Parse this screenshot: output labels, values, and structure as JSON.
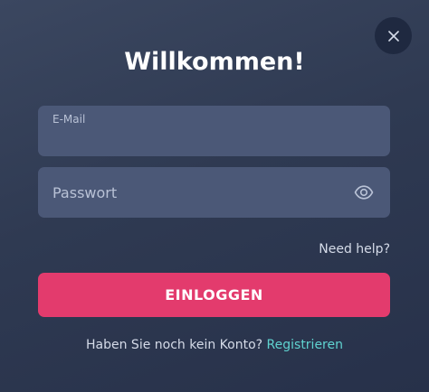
{
  "modal": {
    "title": "Willkommen!",
    "close_icon": "close-icon"
  },
  "form": {
    "email": {
      "label": "E-Mail",
      "value": ""
    },
    "password": {
      "placeholder": "Passwort",
      "value": "",
      "toggle_icon": "eye-icon"
    },
    "help_link": "Need help?",
    "submit_label": "EINLOGGEN"
  },
  "signup": {
    "prompt": "Haben Sie noch kein Konto?",
    "link_label": "Registrieren"
  },
  "colors": {
    "background": "#2f3a52",
    "field_background": "#4b5877",
    "primary_button": "#e33b6d",
    "link_accent": "#5fd3d0",
    "close_button": "#1f2940"
  }
}
